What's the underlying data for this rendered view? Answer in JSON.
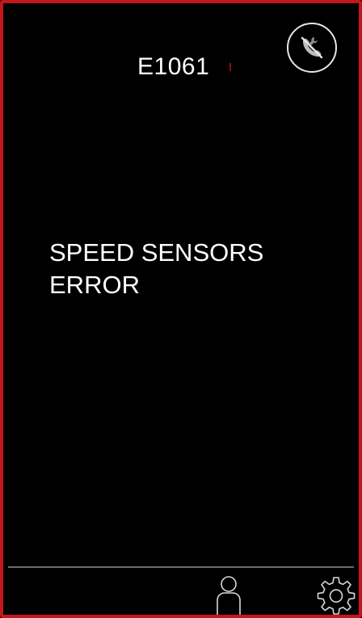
{
  "screen": {
    "error_code": "E1061",
    "message": "SPEED SENSORS\nERROR"
  },
  "icons": {
    "service": "service-disabled-icon",
    "user": "user-icon",
    "settings": "gear-icon"
  },
  "colors": {
    "frame_border": "#c4161c",
    "background": "#000000",
    "text": "#ffffff",
    "divider": "#6a6a6a"
  }
}
